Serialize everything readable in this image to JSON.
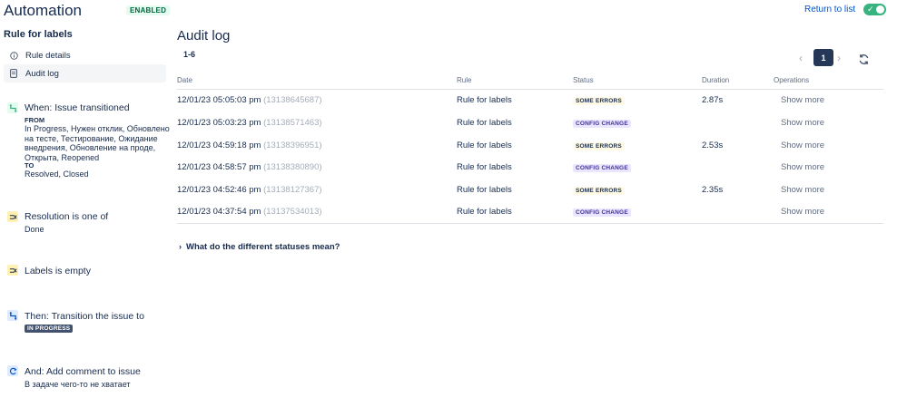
{
  "header": {
    "title": "Automation",
    "status_badge": "ENABLED",
    "return_link": "Return to list"
  },
  "sidebar": {
    "rule_name": "Rule for labels",
    "nav": [
      {
        "label": "Rule details",
        "icon": "info-icon"
      },
      {
        "label": "Audit log",
        "icon": "document-icon"
      }
    ],
    "steps": [
      {
        "title": "When: Issue transitioned",
        "icon": "transition-icon",
        "color": "#36b37e",
        "from_label": "FROM",
        "from_text": "In Progress, Нужен отклик, Обновлено на тесте, Тестирование, Ожидание внедрения, Обновление на проде, Открыта, Reopened",
        "to_label": "TO",
        "to_text": "Resolved, Closed"
      },
      {
        "title": "Resolution is one of",
        "icon": "condition-icon",
        "color": "#ffe380",
        "detail": "Done"
      },
      {
        "title": "Labels is empty",
        "icon": "condition-icon",
        "color": "#ffe380"
      },
      {
        "title": "Then: Transition the issue to",
        "icon": "transition-icon",
        "color": "#4c9aff",
        "lozenge": "IN PROGRESS"
      },
      {
        "title": "And: Add comment to issue",
        "icon": "comment-action-icon",
        "color": "#4c9aff",
        "detail": "В задаче чего-то не хватает"
      }
    ]
  },
  "main": {
    "title": "Audit log",
    "range": "1-6",
    "pagination": {
      "current": "1"
    },
    "columns": [
      "Date",
      "Rule",
      "Status",
      "Duration",
      "Operations"
    ],
    "rows": [
      {
        "date": "12/01/23 05:05:03 pm",
        "id": "(13138645687)",
        "rule": "Rule for labels",
        "status": "SOME ERRORS",
        "status_type": "warn",
        "duration": "2.87s",
        "op": "Show more"
      },
      {
        "date": "12/01/23 05:03:23 pm",
        "id": "(13138571463)",
        "rule": "Rule for labels",
        "status": "CONFIG CHANGE",
        "status_type": "config",
        "duration": "",
        "op": "Show more"
      },
      {
        "date": "12/01/23 04:59:18 pm",
        "id": "(13138396951)",
        "rule": "Rule for labels",
        "status": "SOME ERRORS",
        "status_type": "warn",
        "duration": "2.53s",
        "op": "Show more"
      },
      {
        "date": "12/01/23 04:58:57 pm",
        "id": "(13138380890)",
        "rule": "Rule for labels",
        "status": "CONFIG CHANGE",
        "status_type": "config",
        "duration": "",
        "op": "Show more"
      },
      {
        "date": "12/01/23 04:52:46 pm",
        "id": "(13138127367)",
        "rule": "Rule for labels",
        "status": "SOME ERRORS",
        "status_type": "warn",
        "duration": "2.35s",
        "op": "Show more"
      },
      {
        "date": "12/01/23 04:37:54 pm",
        "id": "(13137534013)",
        "rule": "Rule for labels",
        "status": "CONFIG CHANGE",
        "status_type": "config",
        "duration": "",
        "op": "Show more"
      }
    ],
    "statuses_help": "What do the different statuses mean?"
  },
  "colors": {
    "enabled": "#36b37e",
    "link": "#0052cc",
    "text": "#172b4d",
    "muted": "#a5adba",
    "warn_bg": "#fffae6",
    "config_bg": "#eae6ff"
  }
}
